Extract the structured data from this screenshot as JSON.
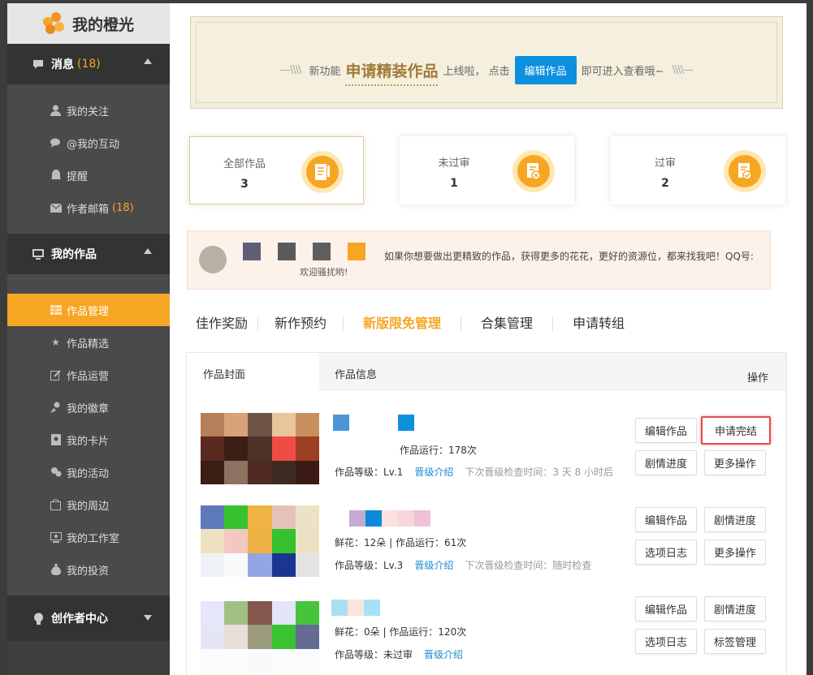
{
  "sidebar": {
    "logo_text": "我的橙光",
    "sections": [
      {
        "label": "消息",
        "badge": "(18)"
      },
      {
        "label": "我的作品"
      },
      {
        "label": "创作者中心"
      }
    ],
    "messages_items": [
      {
        "label": "我的关注",
        "icon": "user-icon"
      },
      {
        "label": "@我的互动",
        "icon": "chat-icon"
      },
      {
        "label": "提醒",
        "icon": "bell-icon"
      },
      {
        "label": "作者邮箱",
        "badge": "(18)",
        "icon": "mail-icon"
      }
    ],
    "works_items": [
      {
        "label": "作品管理",
        "icon": "grid-icon",
        "active": true
      },
      {
        "label": "作品精选",
        "icon": "star-icon"
      },
      {
        "label": "作品运营",
        "icon": "edit-icon"
      },
      {
        "label": "我的徽章",
        "icon": "badge-icon"
      },
      {
        "label": "我的卡片",
        "icon": "card-icon"
      },
      {
        "label": "我的活动",
        "icon": "activity-icon"
      },
      {
        "label": "我的周边",
        "icon": "shop-icon"
      },
      {
        "label": "我的工作室",
        "icon": "studio-icon"
      },
      {
        "label": "我的投资",
        "icon": "money-icon"
      }
    ]
  },
  "banner": {
    "prefix": "新功能",
    "highlight": "申请精装作品",
    "middle": "上线啦，  点击",
    "button": "编辑作品",
    "suffix": "即可进入查看哦~"
  },
  "stats": [
    {
      "label": "全部作品",
      "value": "3"
    },
    {
      "label": "未过审",
      "value": "1"
    },
    {
      "label": "过审",
      "value": "2"
    }
  ],
  "notice": {
    "welcome": "欢迎骚扰哟!",
    "text": "如果你想要做出更精致的作品，获得更多的花花，更好的资源位，都来找我吧！QQ号:"
  },
  "tabs": [
    {
      "label": "佳作奖励"
    },
    {
      "label": "新作预约"
    },
    {
      "label": "新版限免管理",
      "active": true
    },
    {
      "label": "合集管理"
    },
    {
      "label": "申请转组"
    }
  ],
  "table": {
    "headers": {
      "cover": "作品封面",
      "info": "作品信息",
      "action": "操作"
    },
    "rows": [
      {
        "stats": "作品运行：178次",
        "grade": "作品等级：Lv.1",
        "grade_link": "晋级介绍",
        "next_check": "下次晋级检查时间：3 天 8 小时后",
        "buttons": [
          "编辑作品",
          "申请完结",
          "剧情进度",
          "更多操作"
        ]
      },
      {
        "stats": "鲜花：12朵 | 作品运行：61次",
        "grade": "作品等级：Lv.3",
        "grade_link": "晋级介绍",
        "next_check": "下次晋级检查时间：随时检查",
        "buttons": [
          "编辑作品",
          "剧情进度",
          "选项日志",
          "更多操作"
        ]
      },
      {
        "stats": "鲜花：0朵 | 作品运行：120次",
        "grade": "作品等级：未过审",
        "grade_link": "晋级介绍",
        "next_check": "",
        "buttons": [
          "编辑作品",
          "剧情进度",
          "选项日志",
          "标签管理"
        ]
      }
    ]
  },
  "colors": {
    "accent": "#f6a623",
    "link": "#1b8bd0",
    "button_blue": "#0d8fe0",
    "highlight_border": "#e24b4b"
  }
}
